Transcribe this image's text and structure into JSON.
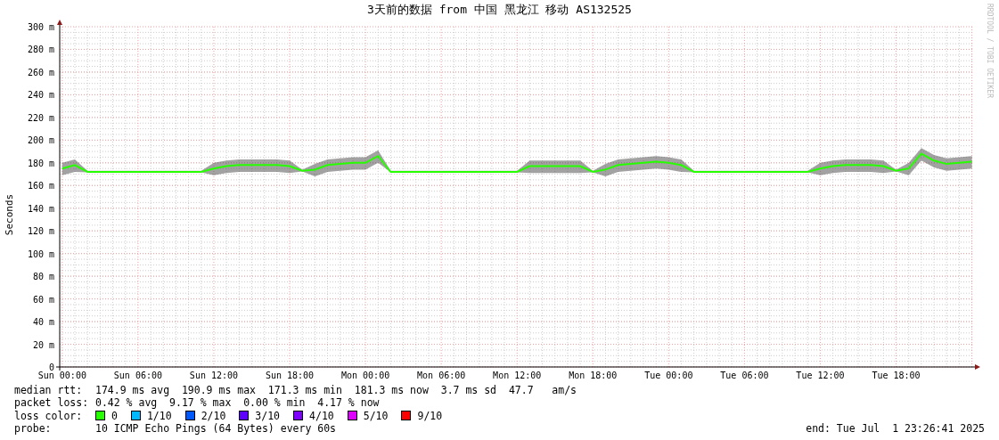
{
  "title": "3天前的数据 from 中国 黑龙江 移动 AS132525",
  "credit": "RRDTOOL / TOBI OETIKER",
  "chart": {
    "chart_data": {
      "type": "line",
      "ylabel": "Seconds",
      "ylim": [
        0,
        300
      ],
      "grid": true,
      "categories": [
        "Sun 00:00",
        null,
        null,
        null,
        null,
        null,
        "Sun 06:00",
        null,
        null,
        null,
        null,
        null,
        "Sun 12:00",
        null,
        null,
        null,
        null,
        null,
        "Sun 18:00",
        null,
        null,
        null,
        null,
        null,
        "Mon 00:00",
        null,
        null,
        null,
        null,
        null,
        "Mon 06:00",
        null,
        null,
        null,
        null,
        null,
        "Mon 12:00",
        null,
        null,
        null,
        null,
        null,
        "Mon 18:00",
        null,
        null,
        null,
        null,
        null,
        "Tue 00:00",
        null,
        null,
        null,
        null,
        null,
        "Tue 06:00",
        null,
        null,
        null,
        null,
        null,
        "Tue 12:00",
        null,
        null,
        null,
        null,
        null,
        "Tue 18:00",
        null,
        null,
        null,
        null,
        null,
        null
      ],
      "series": [
        {
          "color": "#26ff00",
          "values": [
            175,
            178,
            172,
            172,
            172,
            172,
            172,
            172,
            172,
            172,
            172,
            172,
            175,
            177,
            178,
            178,
            178,
            178,
            177,
            173,
            174,
            178,
            179,
            180,
            180,
            186,
            172,
            172,
            172,
            172,
            172,
            172,
            172,
            172,
            172,
            172,
            172,
            177,
            177,
            177,
            177,
            177,
            172,
            174,
            178,
            179,
            180,
            181,
            180,
            178,
            172,
            172,
            172,
            172,
            172,
            172,
            172,
            172,
            172,
            172,
            175,
            177,
            178,
            178,
            178,
            177,
            173,
            175,
            188,
            182,
            179,
            180,
            181
          ]
        }
      ],
      "yticks": [
        {
          "value": 0,
          "label": "0"
        },
        {
          "value": 20,
          "label": "20 m"
        },
        {
          "value": 40,
          "label": "40 m"
        },
        {
          "value": 60,
          "label": "60 m"
        },
        {
          "value": 80,
          "label": "80 m"
        },
        {
          "value": 100,
          "label": "100 m"
        },
        {
          "value": 120,
          "label": "120 m"
        },
        {
          "value": 140,
          "label": "140 m"
        },
        {
          "value": 160,
          "label": "160 m"
        },
        {
          "value": 180,
          "label": "180 m"
        },
        {
          "value": 200,
          "label": "200 m"
        },
        {
          "value": 220,
          "label": "220 m"
        },
        {
          "value": 240,
          "label": "240 m"
        },
        {
          "value": 260,
          "label": "260 m"
        },
        {
          "value": 280,
          "label": "280 m"
        },
        {
          "value": 300,
          "label": "300 m"
        }
      ]
    }
  },
  "stats": [
    {
      "label": "median rtt:",
      "text": "174.9 ms avg  190.9 ms max  171.3 ms min  181.3 ms now  3.7 ms sd  47.7   am/s"
    },
    {
      "label": "packet loss:",
      "text": "0.42 % avg  9.17 % max  0.00 % min  4.17 % now"
    }
  ],
  "loss_legend": {
    "label": "loss color:",
    "items": [
      {
        "label": "0",
        "color": "#26ff00"
      },
      {
        "label": "1/10",
        "color": "#00b8ff"
      },
      {
        "label": "2/10",
        "color": "#0059ff"
      },
      {
        "label": "3/10",
        "color": "#5e00ff"
      },
      {
        "label": "4/10",
        "color": "#7e00ff"
      },
      {
        "label": "5/10",
        "color": "#dd00ff"
      },
      {
        "label": "9/10",
        "color": "#ff0000"
      }
    ]
  },
  "probe": {
    "label": "probe:",
    "text": "10 ICMP Echo Pings (64 Bytes) every 60s"
  },
  "end": "end: Tue Jul  1 23:26:41 2025"
}
